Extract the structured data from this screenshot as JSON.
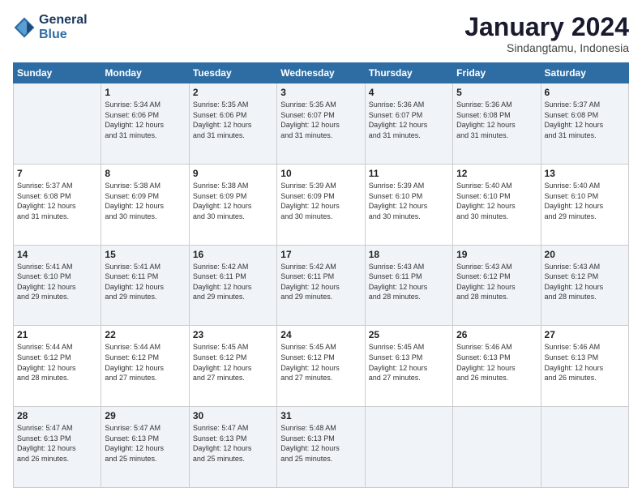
{
  "logo": {
    "line1": "General",
    "line2": "Blue"
  },
  "header": {
    "month": "January 2024",
    "location": "Sindangtamu, Indonesia"
  },
  "weekdays": [
    "Sunday",
    "Monday",
    "Tuesday",
    "Wednesday",
    "Thursday",
    "Friday",
    "Saturday"
  ],
  "weeks": [
    [
      {
        "day": "",
        "info": ""
      },
      {
        "day": "1",
        "info": "Sunrise: 5:34 AM\nSunset: 6:06 PM\nDaylight: 12 hours\nand 31 minutes."
      },
      {
        "day": "2",
        "info": "Sunrise: 5:35 AM\nSunset: 6:06 PM\nDaylight: 12 hours\nand 31 minutes."
      },
      {
        "day": "3",
        "info": "Sunrise: 5:35 AM\nSunset: 6:07 PM\nDaylight: 12 hours\nand 31 minutes."
      },
      {
        "day": "4",
        "info": "Sunrise: 5:36 AM\nSunset: 6:07 PM\nDaylight: 12 hours\nand 31 minutes."
      },
      {
        "day": "5",
        "info": "Sunrise: 5:36 AM\nSunset: 6:08 PM\nDaylight: 12 hours\nand 31 minutes."
      },
      {
        "day": "6",
        "info": "Sunrise: 5:37 AM\nSunset: 6:08 PM\nDaylight: 12 hours\nand 31 minutes."
      }
    ],
    [
      {
        "day": "7",
        "info": "Sunrise: 5:37 AM\nSunset: 6:08 PM\nDaylight: 12 hours\nand 31 minutes."
      },
      {
        "day": "8",
        "info": "Sunrise: 5:38 AM\nSunset: 6:09 PM\nDaylight: 12 hours\nand 30 minutes."
      },
      {
        "day": "9",
        "info": "Sunrise: 5:38 AM\nSunset: 6:09 PM\nDaylight: 12 hours\nand 30 minutes."
      },
      {
        "day": "10",
        "info": "Sunrise: 5:39 AM\nSunset: 6:09 PM\nDaylight: 12 hours\nand 30 minutes."
      },
      {
        "day": "11",
        "info": "Sunrise: 5:39 AM\nSunset: 6:10 PM\nDaylight: 12 hours\nand 30 minutes."
      },
      {
        "day": "12",
        "info": "Sunrise: 5:40 AM\nSunset: 6:10 PM\nDaylight: 12 hours\nand 30 minutes."
      },
      {
        "day": "13",
        "info": "Sunrise: 5:40 AM\nSunset: 6:10 PM\nDaylight: 12 hours\nand 29 minutes."
      }
    ],
    [
      {
        "day": "14",
        "info": "Sunrise: 5:41 AM\nSunset: 6:10 PM\nDaylight: 12 hours\nand 29 minutes."
      },
      {
        "day": "15",
        "info": "Sunrise: 5:41 AM\nSunset: 6:11 PM\nDaylight: 12 hours\nand 29 minutes."
      },
      {
        "day": "16",
        "info": "Sunrise: 5:42 AM\nSunset: 6:11 PM\nDaylight: 12 hours\nand 29 minutes."
      },
      {
        "day": "17",
        "info": "Sunrise: 5:42 AM\nSunset: 6:11 PM\nDaylight: 12 hours\nand 29 minutes."
      },
      {
        "day": "18",
        "info": "Sunrise: 5:43 AM\nSunset: 6:11 PM\nDaylight: 12 hours\nand 28 minutes."
      },
      {
        "day": "19",
        "info": "Sunrise: 5:43 AM\nSunset: 6:12 PM\nDaylight: 12 hours\nand 28 minutes."
      },
      {
        "day": "20",
        "info": "Sunrise: 5:43 AM\nSunset: 6:12 PM\nDaylight: 12 hours\nand 28 minutes."
      }
    ],
    [
      {
        "day": "21",
        "info": "Sunrise: 5:44 AM\nSunset: 6:12 PM\nDaylight: 12 hours\nand 28 minutes."
      },
      {
        "day": "22",
        "info": "Sunrise: 5:44 AM\nSunset: 6:12 PM\nDaylight: 12 hours\nand 27 minutes."
      },
      {
        "day": "23",
        "info": "Sunrise: 5:45 AM\nSunset: 6:12 PM\nDaylight: 12 hours\nand 27 minutes."
      },
      {
        "day": "24",
        "info": "Sunrise: 5:45 AM\nSunset: 6:12 PM\nDaylight: 12 hours\nand 27 minutes."
      },
      {
        "day": "25",
        "info": "Sunrise: 5:45 AM\nSunset: 6:13 PM\nDaylight: 12 hours\nand 27 minutes."
      },
      {
        "day": "26",
        "info": "Sunrise: 5:46 AM\nSunset: 6:13 PM\nDaylight: 12 hours\nand 26 minutes."
      },
      {
        "day": "27",
        "info": "Sunrise: 5:46 AM\nSunset: 6:13 PM\nDaylight: 12 hours\nand 26 minutes."
      }
    ],
    [
      {
        "day": "28",
        "info": "Sunrise: 5:47 AM\nSunset: 6:13 PM\nDaylight: 12 hours\nand 26 minutes."
      },
      {
        "day": "29",
        "info": "Sunrise: 5:47 AM\nSunset: 6:13 PM\nDaylight: 12 hours\nand 25 minutes."
      },
      {
        "day": "30",
        "info": "Sunrise: 5:47 AM\nSunset: 6:13 PM\nDaylight: 12 hours\nand 25 minutes."
      },
      {
        "day": "31",
        "info": "Sunrise: 5:48 AM\nSunset: 6:13 PM\nDaylight: 12 hours\nand 25 minutes."
      },
      {
        "day": "",
        "info": ""
      },
      {
        "day": "",
        "info": ""
      },
      {
        "day": "",
        "info": ""
      }
    ]
  ]
}
